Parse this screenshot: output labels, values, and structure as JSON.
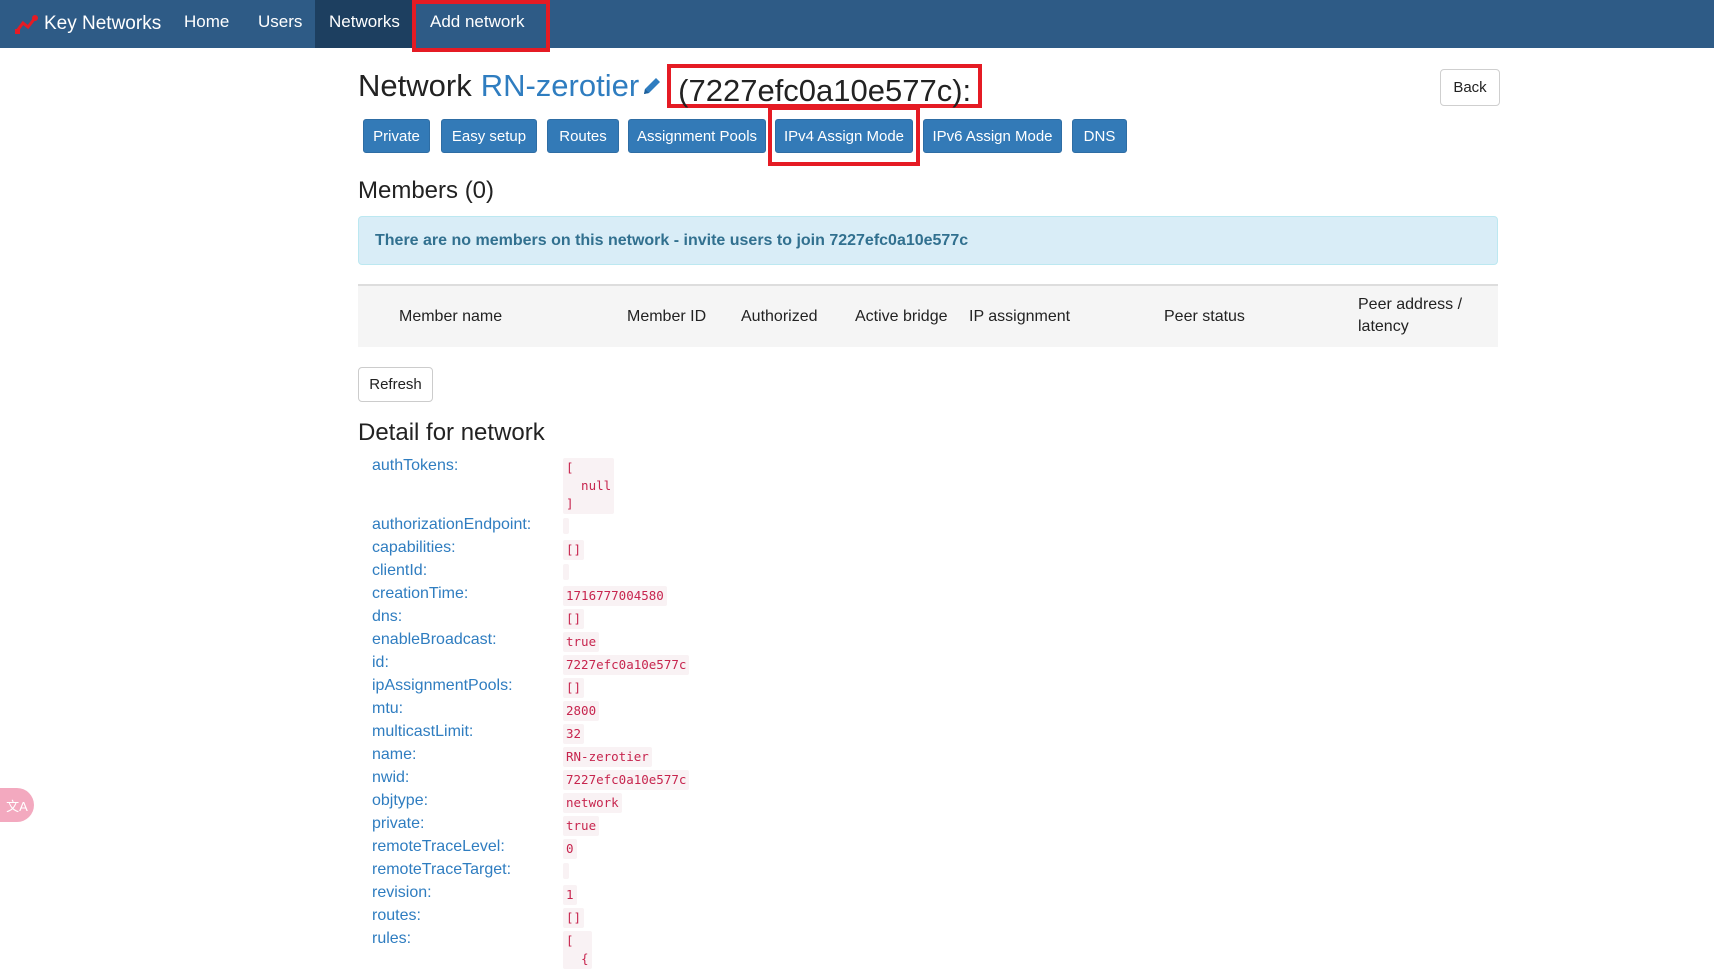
{
  "nav": {
    "brand": "Key Networks",
    "items": [
      {
        "label": "Home"
      },
      {
        "label": "Users"
      },
      {
        "label": "Networks"
      },
      {
        "label": "Add network"
      }
    ]
  },
  "header": {
    "prefix": "Network",
    "network_name": "RN-zerotier",
    "network_id_label": "(7227efc0a10e577c):",
    "back_label": "Back"
  },
  "buttons": [
    {
      "label": "Private"
    },
    {
      "label": "Easy setup"
    },
    {
      "label": "Routes"
    },
    {
      "label": "Assignment Pools"
    },
    {
      "label": "IPv4 Assign Mode"
    },
    {
      "label": "IPv6 Assign Mode"
    },
    {
      "label": "DNS"
    }
  ],
  "members": {
    "title": "Members (0)",
    "alert": "There are no members on this network - invite users to join 7227efc0a10e577c",
    "columns": [
      "Member name",
      "Member ID",
      "Authorized",
      "Active bridge",
      "IP assignment",
      "Peer status",
      "Peer address /",
      "latency"
    ],
    "refresh_label": "Refresh"
  },
  "detail": {
    "title": "Detail for network",
    "rows": [
      {
        "key": "authTokens:",
        "value": "[\n  null\n]"
      },
      {
        "key": "authorizationEndpoint:",
        "value": ""
      },
      {
        "key": "capabilities:",
        "value": "[]"
      },
      {
        "key": "clientId:",
        "value": ""
      },
      {
        "key": "creationTime:",
        "value": "1716777004580"
      },
      {
        "key": "dns:",
        "value": "[]"
      },
      {
        "key": "enableBroadcast:",
        "value": "true"
      },
      {
        "key": "id:",
        "value": "7227efc0a10e577c"
      },
      {
        "key": "ipAssignmentPools:",
        "value": "[]"
      },
      {
        "key": "mtu:",
        "value": "2800"
      },
      {
        "key": "multicastLimit:",
        "value": "32"
      },
      {
        "key": "name:",
        "value": "RN-zerotier"
      },
      {
        "key": "nwid:",
        "value": "7227efc0a10e577c"
      },
      {
        "key": "objtype:",
        "value": "network"
      },
      {
        "key": "private:",
        "value": "true"
      },
      {
        "key": "remoteTraceLevel:",
        "value": "0"
      },
      {
        "key": "remoteTraceTarget:",
        "value": ""
      },
      {
        "key": "revision:",
        "value": "1"
      },
      {
        "key": "routes:",
        "value": "[]"
      },
      {
        "key": "rules:",
        "value": "[\n  {"
      }
    ]
  },
  "widget": {
    "label": "文A"
  },
  "colors": {
    "navbar": "#2e5b86",
    "primary_button": "#337ab7",
    "highlight": "#e51b24",
    "link": "#2f7dc0",
    "code_text": "#c7254e"
  }
}
